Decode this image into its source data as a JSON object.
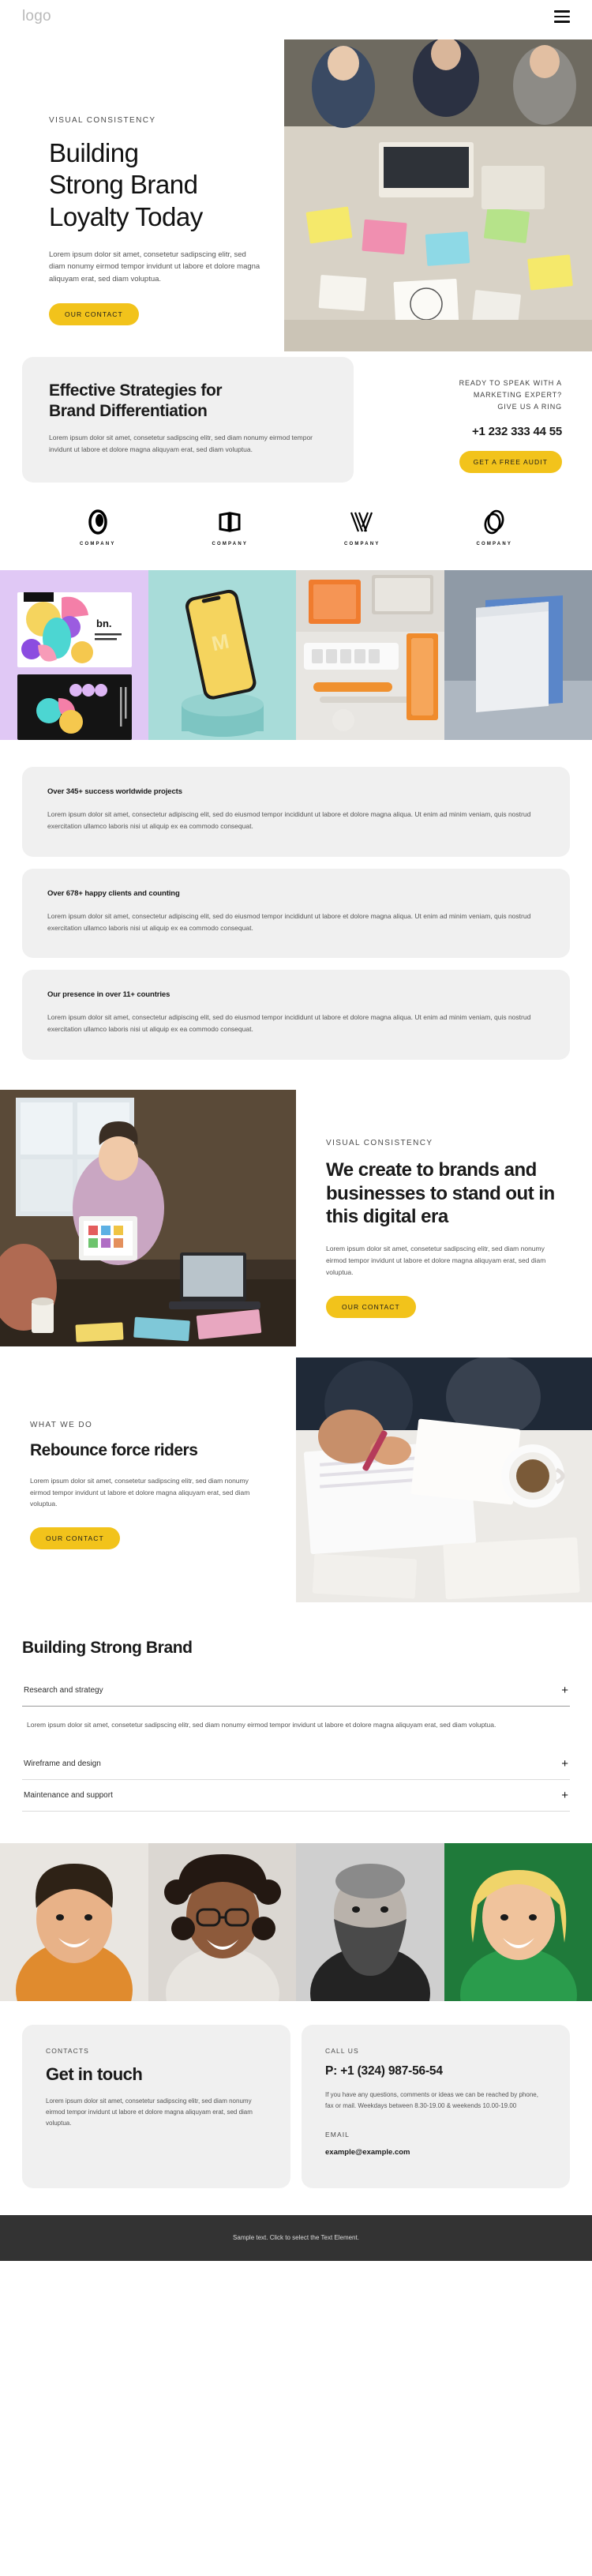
{
  "header": {
    "logo": "logo",
    "menu_icon": "hamburger-menu-icon"
  },
  "hero": {
    "eyebrow": "VISUAL CONSISTENCY",
    "title_line1": "Building",
    "title_line2": "Strong Brand",
    "title_line3": "Loyalty Today",
    "paragraph": "Lorem ipsum dolor sit amet, consetetur sadipscing elitr, sed diam nonumy eirmod tempor invidunt ut labore et dolore magna aliquyam erat, sed diam voluptua.",
    "button": "OUR CONTACT"
  },
  "strategies": {
    "title_line1": "Effective Strategies for",
    "title_line2": "Brand Differentiation",
    "paragraph": "Lorem ipsum dolor sit amet, consetetur sadipscing elitr, sed diam nonumy eirmod tempor invidunt ut labore et dolore magna aliquyam erat, sed diam voluptua.",
    "ring_line1": "READY TO SPEAK WITH A",
    "ring_line2": "MARKETING EXPERT?",
    "ring_line3": "GIVE US A RING",
    "phone": "+1 232 333 44 55",
    "button": "GET A FREE AUDIT"
  },
  "client_logos": [
    {
      "name": "COMPANY",
      "icon": "ring-logo-icon"
    },
    {
      "name": "COMPANY",
      "icon": "book-logo-icon"
    },
    {
      "name": "COMPANY",
      "icon": "chevron-stripes-logo-icon"
    },
    {
      "name": "COMPANY",
      "icon": "oval-loop-logo-icon"
    }
  ],
  "gallery": [
    {
      "name": "business-card-branding-image"
    },
    {
      "name": "phone-mockup-image"
    },
    {
      "name": "desk-stationery-image"
    },
    {
      "name": "folder-mockup-image"
    }
  ],
  "stats": [
    {
      "title": "Over 345+ success worldwide projects",
      "body": "Lorem ipsum dolor sit amet, consectetur adipiscing elit, sed do eiusmod tempor incididunt ut labore et dolore magna aliqua. Ut enim ad minim veniam, quis nostrud exercitation ullamco laboris nisi ut aliquip ex ea commodo consequat."
    },
    {
      "title": "Over 678+ happy clients and counting",
      "body": "Lorem ipsum dolor sit amet, consectetur adipiscing elit, sed do eiusmod tempor incididunt ut labore et dolore magna aliqua. Ut enim ad minim veniam, quis nostrud exercitation ullamco laboris nisi ut aliquip ex ea commodo consequat."
    },
    {
      "title": "Our presence in over 11+ countries",
      "body": "Lorem ipsum dolor sit amet, consectetur adipiscing elit, sed do eiusmod tempor incididunt ut labore et dolore magna aliqua. Ut enim ad minim veniam, quis nostrud exercitation ullamco laboris nisi ut aliquip ex ea commodo consequat."
    }
  ],
  "create_section": {
    "eyebrow": "VISUAL CONSISTENCY",
    "title": "We create to brands and businesses to stand out in this digital era",
    "paragraph": "Lorem ipsum dolor sit amet, consetetur sadipscing elitr, sed diam nonumy eirmod tempor invidunt ut labore et dolore magna aliquyam erat, sed diam voluptua.",
    "button": "OUR CONTACT",
    "image": "designer-with-color-swatches-image"
  },
  "rebounce_section": {
    "eyebrow": "WHAT WE DO",
    "title": "Rebounce force riders",
    "paragraph": "Lorem ipsum dolor sit amet, consetetur sadipscing elitr, sed diam nonumy eirmod tempor invidunt ut labore et dolore magna aliquyam erat, sed diam voluptua.",
    "button": "OUR CONTACT",
    "image": "meeting-with-coffee-image"
  },
  "accordion": {
    "title": "Building Strong Brand",
    "items": [
      {
        "label": "Research and strategy",
        "icon": "plus-icon",
        "open": true,
        "body": "Lorem ipsum dolor sit amet, consetetur sadipscing elitr, sed diam nonumy eirmod tempor invidunt ut labore et dolore magna aliquyam erat, sed diam voluptua."
      },
      {
        "label": "Wireframe and design",
        "icon": "plus-icon",
        "open": false,
        "body": ""
      },
      {
        "label": "Maintenance and support",
        "icon": "plus-icon",
        "open": false,
        "body": ""
      }
    ]
  },
  "team": [
    {
      "name": "team-member-portrait-1"
    },
    {
      "name": "team-member-portrait-2"
    },
    {
      "name": "team-member-portrait-3"
    },
    {
      "name": "team-member-portrait-4"
    }
  ],
  "contact": {
    "left": {
      "label": "CONTACTS",
      "title": "Get in touch",
      "paragraph": "Lorem ipsum dolor sit amet, consetetur sadipscing elitr, sed diam nonumy eirmod tempor invidunt ut labore et dolore magna aliquyam erat, sed diam voluptua."
    },
    "right": {
      "label": "CALL US",
      "phone": "P: +1 (324) 987-56-54",
      "paragraph": "If you have any questions, comments or ideas we can be reached by phone, fax or mail. Weekdays between 8.30-19.00 & weekends 10.00-19.00",
      "email_label": "EMAIL",
      "email": "example@example.com"
    }
  },
  "footer": {
    "text": "Sample text. Click to select the Text Element."
  },
  "colors": {
    "accent": "#f2c31b",
    "panel": "#f0f0f0",
    "footer_bg": "#333333",
    "text": "#1a1a1a"
  }
}
